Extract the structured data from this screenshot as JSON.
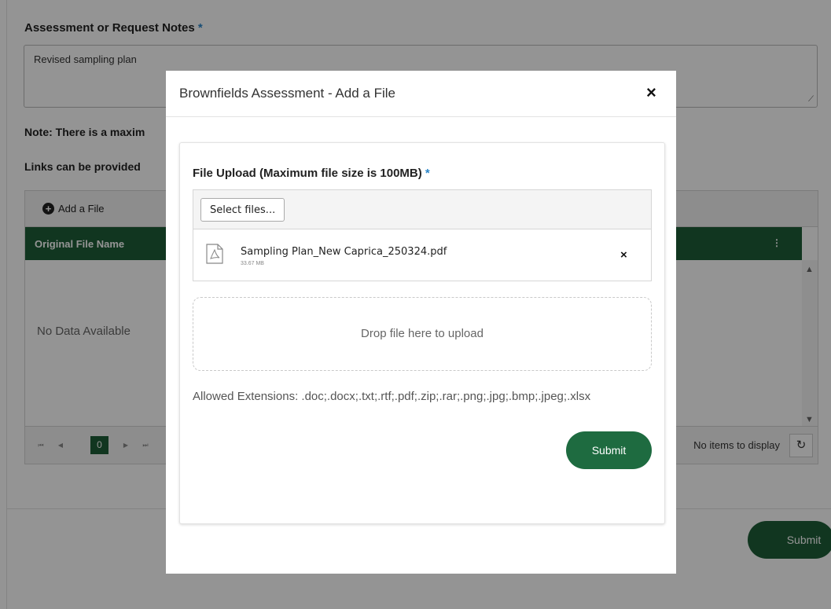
{
  "background": {
    "notes_label": "Assessment or Request Notes",
    "required_mark": "*",
    "notes_value": "Revised sampling plan",
    "note_text": "Note: There is a maxim",
    "links_text": "Links can be provided",
    "grid": {
      "add_file_label": "Add a File",
      "column_header": "Original File Name",
      "empty_text": "No Data Available",
      "page_number": "0",
      "items_text": "No items to display"
    },
    "submit_label": "Submit"
  },
  "modal": {
    "title": "Brownfields Assessment - Add a File",
    "close_label": "×",
    "upload_label": "File Upload (Maximum file size is 100MB)",
    "required_mark": "*",
    "select_files_label": "Select files...",
    "file": {
      "name": "Sampling Plan_New Caprica_250324.pdf",
      "size": "33.67 MB",
      "remove_label": "×"
    },
    "drop_text": "Drop file here to upload",
    "allowed_text": "Allowed Extensions: .doc;.docx;.txt;.rtf;.pdf;.zip;.rar;.png;.jpg;.bmp;.jpeg;.xlsx",
    "submit_label": "Submit"
  },
  "colors": {
    "primary_green": "#1e5e37",
    "required_blue": "#2a86c9",
    "overlay": "rgba(0,0,0,0.42)"
  },
  "icons": {
    "add": "plus-circle-icon",
    "menu": "vertical-dots-icon",
    "refresh": "refresh-icon",
    "file": "pdf-file-icon",
    "close": "close-icon"
  }
}
